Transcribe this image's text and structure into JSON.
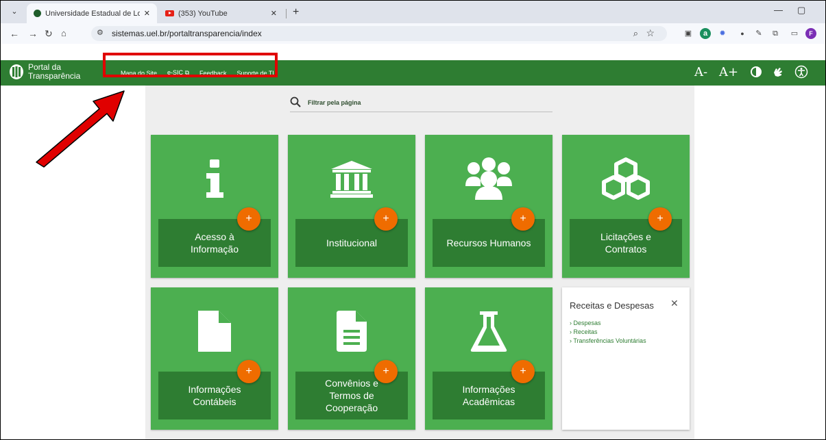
{
  "browser": {
    "tabs": [
      {
        "title": "Universidade Estadual de Londr",
        "close": "✕"
      },
      {
        "title": "(353) YouTube",
        "close": "✕"
      }
    ],
    "new_tab": "+",
    "url": "sistemas.uel.br/portaltransparencia/index",
    "profile_initial": "F"
  },
  "site": {
    "logo_line1": "Portal da",
    "logo_line2": "Transparência",
    "nav": [
      "Mapa do Site",
      "e-SIC",
      "Feedback",
      "Suporte de TI"
    ],
    "a11y": {
      "decrease_font": "A-",
      "increase_font": "A+"
    }
  },
  "filter": {
    "label": "Filtrar pela página"
  },
  "cards": [
    {
      "label": "Acesso à\nInformação",
      "icon": "info-icon"
    },
    {
      "label": "Institucional",
      "icon": "institution-icon"
    },
    {
      "label": "Recursos Humanos",
      "icon": "people-icon"
    },
    {
      "label": "Licitações e\nContratos",
      "icon": "boxes-icon"
    },
    {
      "label": "Informações\nContábeis",
      "icon": "file-icon"
    },
    {
      "label": "Convênios e\nTermos de\nCooperação",
      "icon": "document-icon"
    },
    {
      "label": "Informações\nAcadêmicas",
      "icon": "flask-icon"
    }
  ],
  "plus": "+",
  "popup": {
    "title": "Receitas e Despesas",
    "close": "✕",
    "items": [
      "Despesas",
      "Receitas",
      "Transferências Voluntárias"
    ]
  },
  "colors": {
    "header_green": "#2e7d32",
    "card_green": "#4caf50",
    "plus_orange": "#ef6c00",
    "annotation_red": "#e00000"
  }
}
